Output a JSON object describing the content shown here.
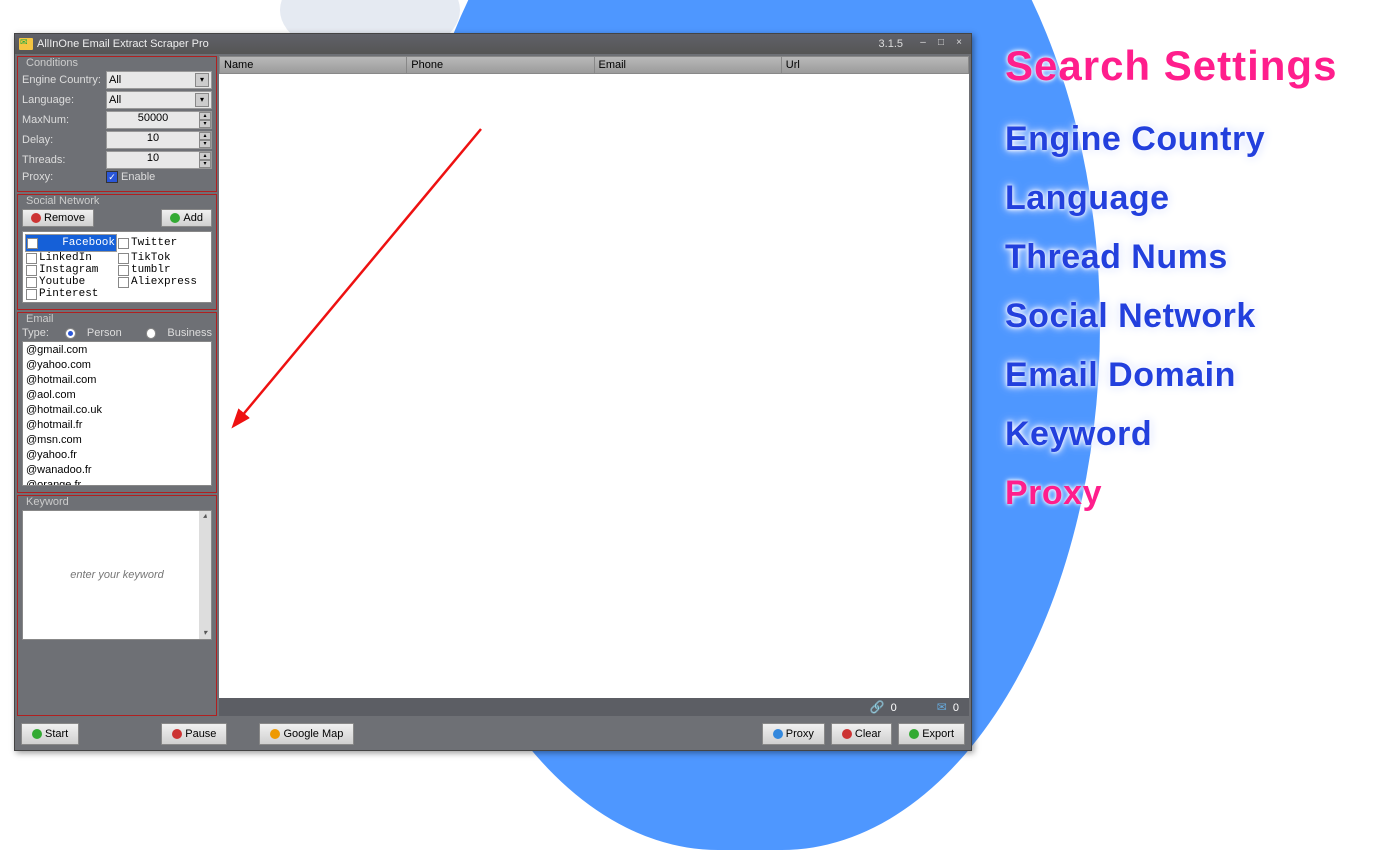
{
  "window": {
    "title": "AllInOne Email Extract Scraper Pro",
    "version": "3.1.5"
  },
  "conditions": {
    "title": "Conditions",
    "engine_label": "Engine Country:",
    "engine_value": "All",
    "language_label": "Language:",
    "language_value": "All",
    "maxnum_label": "MaxNum:",
    "maxnum_value": "50000",
    "delay_label": "Delay:",
    "delay_value": "10",
    "threads_label": "Threads:",
    "threads_value": "10",
    "proxy_label": "Proxy:",
    "proxy_enable": "Enable"
  },
  "social": {
    "title": "Social Network",
    "remove": "Remove",
    "add": "Add",
    "items": [
      "Facebook",
      "Twitter",
      "LinkedIn",
      "TikTok",
      "Instagram",
      "tumblr",
      "Youtube",
      "Aliexpress",
      "Pinterest"
    ]
  },
  "email": {
    "title": "Email",
    "type_label": "Type:",
    "person": "Person",
    "business": "Business",
    "domains": [
      "@gmail.com",
      "@yahoo.com",
      "@hotmail.com",
      "@aol.com",
      "@hotmail.co.uk",
      "@hotmail.fr",
      "@msn.com",
      "@yahoo.fr",
      "@wanadoo.fr",
      "@orange.fr"
    ]
  },
  "keyword": {
    "title": "Keyword",
    "placeholder": "enter your keyword"
  },
  "table": {
    "cols": [
      "Name",
      "Phone",
      "Email",
      "Url"
    ]
  },
  "status": {
    "attach": "0",
    "mail": "0"
  },
  "footer": {
    "start": "Start",
    "pause": "Pause",
    "gmap": "Google Map",
    "proxy": "Proxy",
    "clear": "Clear",
    "export": "Export"
  },
  "annotations": {
    "title": "Search Settings",
    "items": [
      "Engine Country",
      "Language",
      "Thread Nums",
      "Social Network",
      "Email Domain",
      "Keyword",
      "Proxy"
    ]
  }
}
